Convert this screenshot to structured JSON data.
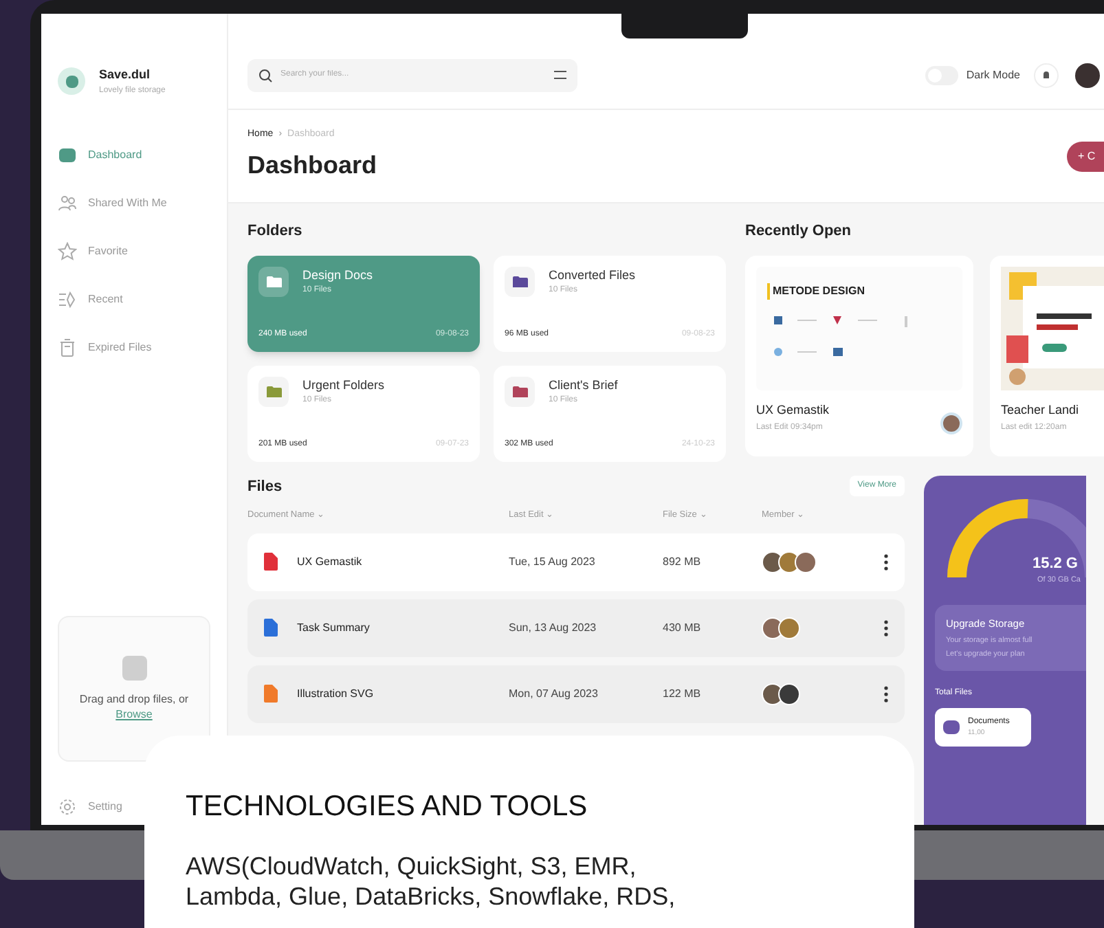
{
  "sidebar": {
    "app_name": "Save.dul",
    "tagline": "Lovely file storage",
    "items": [
      {
        "label": "Dashboard",
        "selected": true
      },
      {
        "label": "Shared With Me",
        "selected": false
      },
      {
        "label": "Favorite",
        "selected": false
      },
      {
        "label": "Recent",
        "selected": false
      },
      {
        "label": "Expired Files",
        "selected": false
      }
    ],
    "upload": {
      "text": "Drag and drop files, or",
      "link": "Browse"
    },
    "settings": "Setting"
  },
  "topbar": {
    "search": {
      "placeholder": "Search your files..."
    },
    "dark_mode": {
      "label": "Dark Mode",
      "on": false
    }
  },
  "header": {
    "breadcrumb": [
      "Home",
      "›",
      "Dashboard"
    ],
    "title": "Dashboard",
    "create_button": "+ C"
  },
  "folders": {
    "title": "Folders",
    "items": [
      {
        "name": "Design Docs",
        "count": "10 Files",
        "used": "240 MB used",
        "date": "09-08-23",
        "selected": true,
        "color": "#ffffff"
      },
      {
        "name": "Converted Files",
        "count": "10 Files",
        "used": "96 MB used",
        "date": "09-08-23",
        "selected": false,
        "color": "#5b4a9b"
      },
      {
        "name": "Urgent Folders",
        "count": "10 Files",
        "used": "201 MB used",
        "date": "09-07-23",
        "selected": false,
        "color": "#8a9a3a"
      },
      {
        "name": "Client's Brief",
        "count": "10 Files",
        "used": "302 MB used",
        "date": "24-10-23",
        "selected": false,
        "color": "#b0435a"
      }
    ]
  },
  "recent": {
    "title": "Recently Open",
    "items": [
      {
        "kind": "diagram",
        "heading": "METODE DESIGN",
        "name": "UX Gemastik",
        "edited": "Last Edit 09:34pm"
      },
      {
        "kind": "picture",
        "name": "Teacher Landi",
        "edited": "Last edit 12:20am"
      }
    ]
  },
  "files": {
    "title": "Files",
    "view_more": "View More",
    "columns": [
      "Document Name",
      "Last Edit",
      "File Size",
      "Member"
    ],
    "sort_mark": "⌄",
    "rows": [
      {
        "name": "UX Gemastik",
        "edited": "Tue, 15 Aug 2023",
        "size": "892 MB",
        "selected": true,
        "color": "#e0303a",
        "members": [
          {
            "color": "#6b5a4a"
          },
          {
            "color": "#a07a3a"
          },
          {
            "color": "#8a6a5a"
          }
        ]
      },
      {
        "name": "Task Summary",
        "edited": "Sun, 13 Aug 2023",
        "size": "430 MB",
        "selected": false,
        "color": "#2b6fd8",
        "members": [
          {
            "color": "#8a6a5a"
          },
          {
            "color": "#a07a3a"
          }
        ]
      },
      {
        "name": "Illustration SVG",
        "edited": "Mon, 07 Aug 2023",
        "size": "122 MB",
        "selected": false,
        "color": "#f07a2a",
        "members": [
          {
            "color": "#6b5a4a"
          },
          {
            "color": "#3a3a3a"
          }
        ]
      }
    ]
  },
  "storage": {
    "level": 0.51,
    "used": "15.2 G",
    "capacity": "Of 30 GB Ca",
    "upgrade_title": "Upgrade Storage",
    "upgrade_text": "Your storage is almost full",
    "upgrade_text_2": "Let's upgrade your plan",
    "total_files": "Total Files",
    "categories": [
      {
        "name": "Documents",
        "count": "11,00"
      }
    ]
  },
  "card": {
    "title": "TECHNOLOGIES AND TOOLS",
    "text": "AWS(CloudWatch, QuickSight, S3, EMR, Lambda, Glue, DataBricks, Snowflake, RDS,"
  }
}
